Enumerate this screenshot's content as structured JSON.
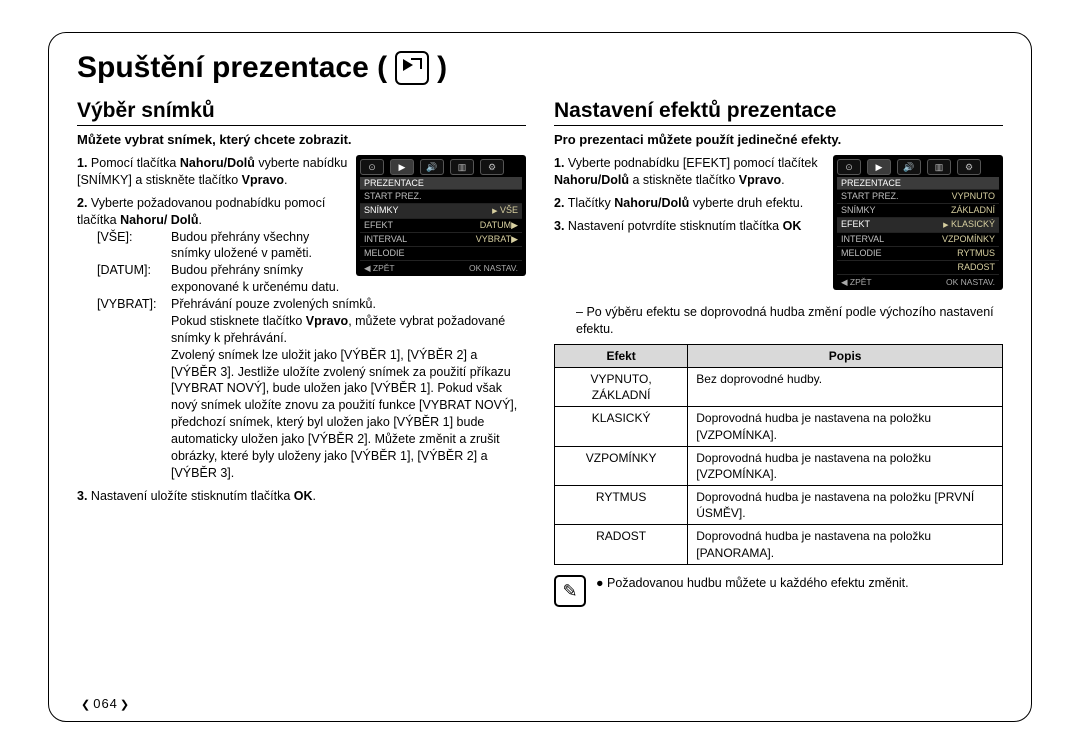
{
  "page_number": "064",
  "title": "Spuštění prezentace (",
  "title_close": ")",
  "left": {
    "heading": "Výběr snímků",
    "lead": "Můžete vybrat snímek, který chcete zobrazit.",
    "step1_a": "Pomocí tlačítka ",
    "step1_b": "Nahoru/Dolů",
    "step1_c": " vyberte nabídku [SNÍMKY] a stiskněte tlačítko ",
    "step1_d": "Vpravo",
    "step1_e": ".",
    "step2_a": "Vyberte požadovanou podnabídku pomocí tlačítka ",
    "step2_b": "Nahoru/ Dolů",
    "step2_c": ".",
    "opt_all_k": "[VŠE]:",
    "opt_all_v": "Budou přehrány všechny snímky uložené v paměti.",
    "opt_date_k": "[DATUM]:",
    "opt_date_v": "Budou přehrány snímky exponované k určenému datu.",
    "opt_sel_k": "[VYBRAT]:",
    "opt_sel_v": "Přehrávání pouze zvolených snímků.",
    "para_a": "Pokud stisknete tlačítko ",
    "para_b": "Vpravo",
    "para_c": ", můžete vybrat požadované snímky k přehrávání.",
    "para2": "Zvolený snímek lze uložit jako [VÝBĚR 1], [VÝBĚR 2] a [VÝBĚR 3]. Jestliže uložíte zvolený snímek za použití příkazu [VYBRAT NOVÝ], bude uložen jako [VÝBĚR 1]. Pokud však nový snímek uložíte znovu za použití funkce [VYBRAT NOVÝ], předchozí snímek, který byl uložen jako [VÝBĚR 1] bude automaticky uložen jako [VÝBĚR 2]. Můžete změnit a zrušit obrázky, které byly uloženy jako [VÝBĚR 1], [VÝBĚR 2] a [VÝBĚR 3].",
    "step3_a": "Nastavení uložíte stisknutím tlačítka ",
    "step3_b": "OK",
    "step3_c": ".",
    "screen": {
      "header": "PREZENTACE",
      "rows": [
        {
          "l": "START PREZ.",
          "r": ""
        },
        {
          "l": "SNÍMKY",
          "r": "VŠE",
          "sel": true
        },
        {
          "l": "EFEKT",
          "r": "DATUM▶"
        },
        {
          "l": "INTERVAL",
          "r": "VYBRAT▶"
        },
        {
          "l": "MELODIE",
          "r": ""
        }
      ],
      "foot_l": "◀  ZPĚT",
      "foot_r": "OK  NASTAV."
    }
  },
  "right": {
    "heading": "Nastavení efektů prezentace",
    "lead": "Pro prezentaci můžete použít jedinečné efekty.",
    "s1_a": "Vyberte podnabídku [EFEKT] pomocí tlačítek ",
    "s1_b": "Nahoru/Dolů",
    "s1_c": " a stiskněte tlačítko ",
    "s1_d": "Vpravo",
    "s1_e": ".",
    "s2_a": "Tlačítky ",
    "s2_b": "Nahoru/Dolů",
    "s2_c": " vyberte druh efektu.",
    "s3_a": "Nastavení potvrdíte stisknutím tlačítka ",
    "s3_b": "OK",
    "bullet": "Po výběru efektu se doprovodná hudba změní podle výchozího nastavení efektu.",
    "table": {
      "h1": "Efekt",
      "h2": "Popis",
      "rows": [
        {
          "e": "VYPNUTO, ZÁKLADNÍ",
          "d": "Bez doprovodné hudby."
        },
        {
          "e": "KLASICKÝ",
          "d": "Doprovodná hudba je nastavena na položku [VZPOMÍNKA]."
        },
        {
          "e": "VZPOMÍNKY",
          "d": "Doprovodná hudba je nastavena na položku [VZPOMÍNKA]."
        },
        {
          "e": "RYTMUS",
          "d": "Doprovodná hudba je nastavena na položku [PRVNÍ ÚSMĚV]."
        },
        {
          "e": "RADOST",
          "d": "Doprovodná hudba je nastavena na položku [PANORAMA]."
        }
      ]
    },
    "note": "Požadovanou hudbu můžete u každého efektu změnit.",
    "screen": {
      "header": "PREZENTACE",
      "rows": [
        {
          "l": "START PREZ.",
          "r": "VYPNUTO"
        },
        {
          "l": "SNÍMKY",
          "r": "ZÁKLADNÍ"
        },
        {
          "l": "EFEKT",
          "r": "KLASICKÝ",
          "sel": true
        },
        {
          "l": "INTERVAL",
          "r": "VZPOMÍNKY"
        },
        {
          "l": "MELODIE",
          "r": "RYTMUS"
        },
        {
          "l": "",
          "r": "RADOST"
        }
      ],
      "foot_l": "◀  ZPĚT",
      "foot_r": "OK  NASTAV."
    }
  }
}
